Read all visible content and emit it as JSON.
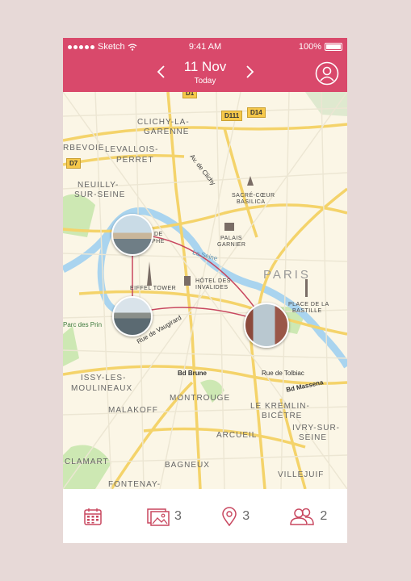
{
  "status_bar": {
    "carrier": "Sketch",
    "time": "9:41 AM",
    "battery": "100%"
  },
  "header": {
    "date": "11 Nov",
    "subtitle": "Today"
  },
  "map": {
    "district_labels": [
      "Clichy-la-",
      "Garenne",
      "Levallois-",
      "Perret",
      "Neuilly-",
      "sur-Seine",
      "Paris",
      "Issy-les-",
      "Moulineaux",
      "Malakoff",
      "Montrouge",
      "Le Kremlin-",
      "Bicêtre",
      "Ivry-sur-",
      "Seine",
      "Arcueil",
      "Bagneux",
      "Clamart",
      "Fontenay-",
      "Villejuif",
      "rbevoie"
    ],
    "landmarks": [
      "Sacré-Cœur",
      "Basilica",
      "Palais",
      "Garnier",
      "Eiffel Tower",
      "Hôtel des",
      "Invalides",
      "Place de la",
      "Bastille",
      "de",
      "phe"
    ],
    "streets": [
      "Av. de Clichy",
      "La Seine",
      "Rue de Vaugirard",
      "Bd Brune",
      "Rue de Tolbiac",
      "Bd Massena",
      "Parc des Prin"
    ],
    "road_badges": [
      "D111",
      "D14",
      "D7",
      "D1"
    ]
  },
  "tabs": {
    "calendar": {
      "count": ""
    },
    "photos": {
      "count": "3"
    },
    "places": {
      "count": "3"
    },
    "people": {
      "count": "2"
    }
  },
  "colors": {
    "accent": "#d9496b",
    "route": "#c8475f"
  }
}
